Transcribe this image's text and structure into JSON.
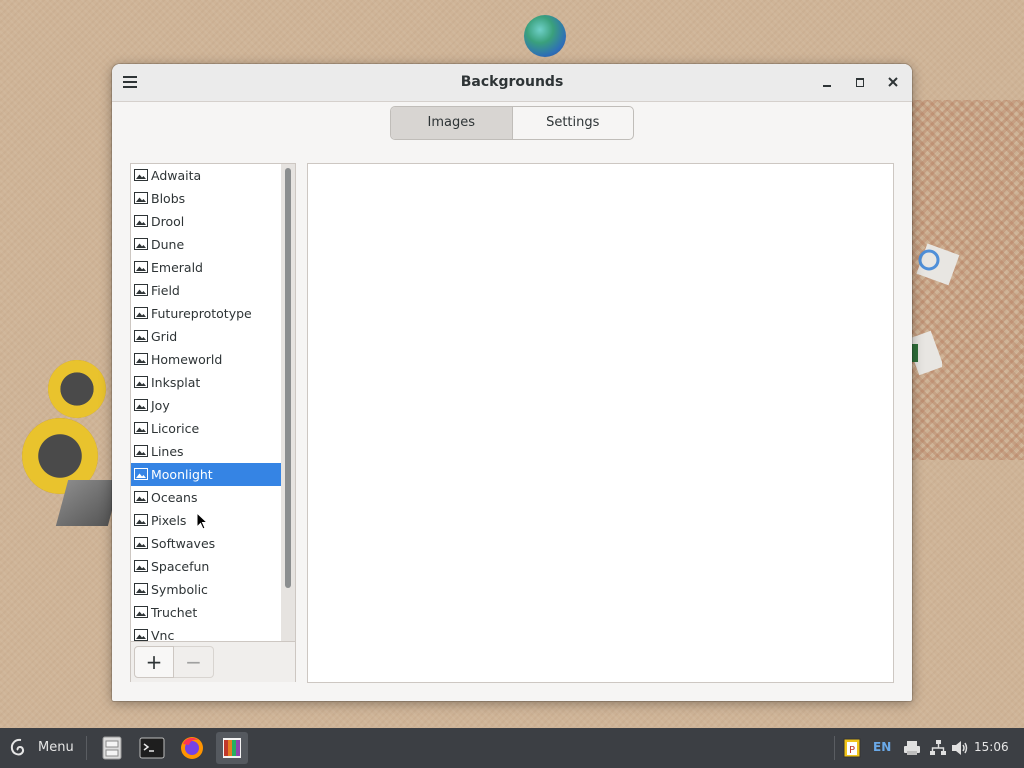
{
  "window": {
    "title": "Backgrounds",
    "menu_icon": "hamburger-menu-icon",
    "controls": [
      "minimize-icon",
      "maximize-icon",
      "close-icon"
    ]
  },
  "tabs": [
    {
      "label": "Images",
      "active": true
    },
    {
      "label": "Settings",
      "active": false
    }
  ],
  "backgrounds": {
    "items": [
      {
        "label": "Adwaita"
      },
      {
        "label": "Blobs"
      },
      {
        "label": "Drool"
      },
      {
        "label": "Dune"
      },
      {
        "label": "Emerald"
      },
      {
        "label": "Field"
      },
      {
        "label": "Futureprototype"
      },
      {
        "label": "Grid"
      },
      {
        "label": "Homeworld"
      },
      {
        "label": "Inksplat"
      },
      {
        "label": "Joy"
      },
      {
        "label": "Licorice"
      },
      {
        "label": "Lines"
      },
      {
        "label": "Moonlight",
        "selected": true
      },
      {
        "label": "Oceans"
      },
      {
        "label": "Pixels"
      },
      {
        "label": "Softwaves"
      },
      {
        "label": "Spacefun"
      },
      {
        "label": "Symbolic"
      },
      {
        "label": "Truchet"
      },
      {
        "label": "Vnc"
      }
    ],
    "item_icon": "image-file-icon",
    "add_label": "+",
    "remove_label": "−"
  },
  "taskbar": {
    "menu_label": "Menu",
    "launchers": [
      "file-manager-icon",
      "terminal-icon",
      "firefox-icon",
      "backgrounds-app-icon"
    ],
    "language": "EN",
    "tray_icons": [
      "clipboard-icon",
      "printer-icon",
      "network-icon",
      "volume-icon"
    ],
    "clock": "15:06"
  },
  "colors": {
    "accent": "#3584e4",
    "taskbar": "#3c3f44",
    "desktop": "#cfb497"
  }
}
